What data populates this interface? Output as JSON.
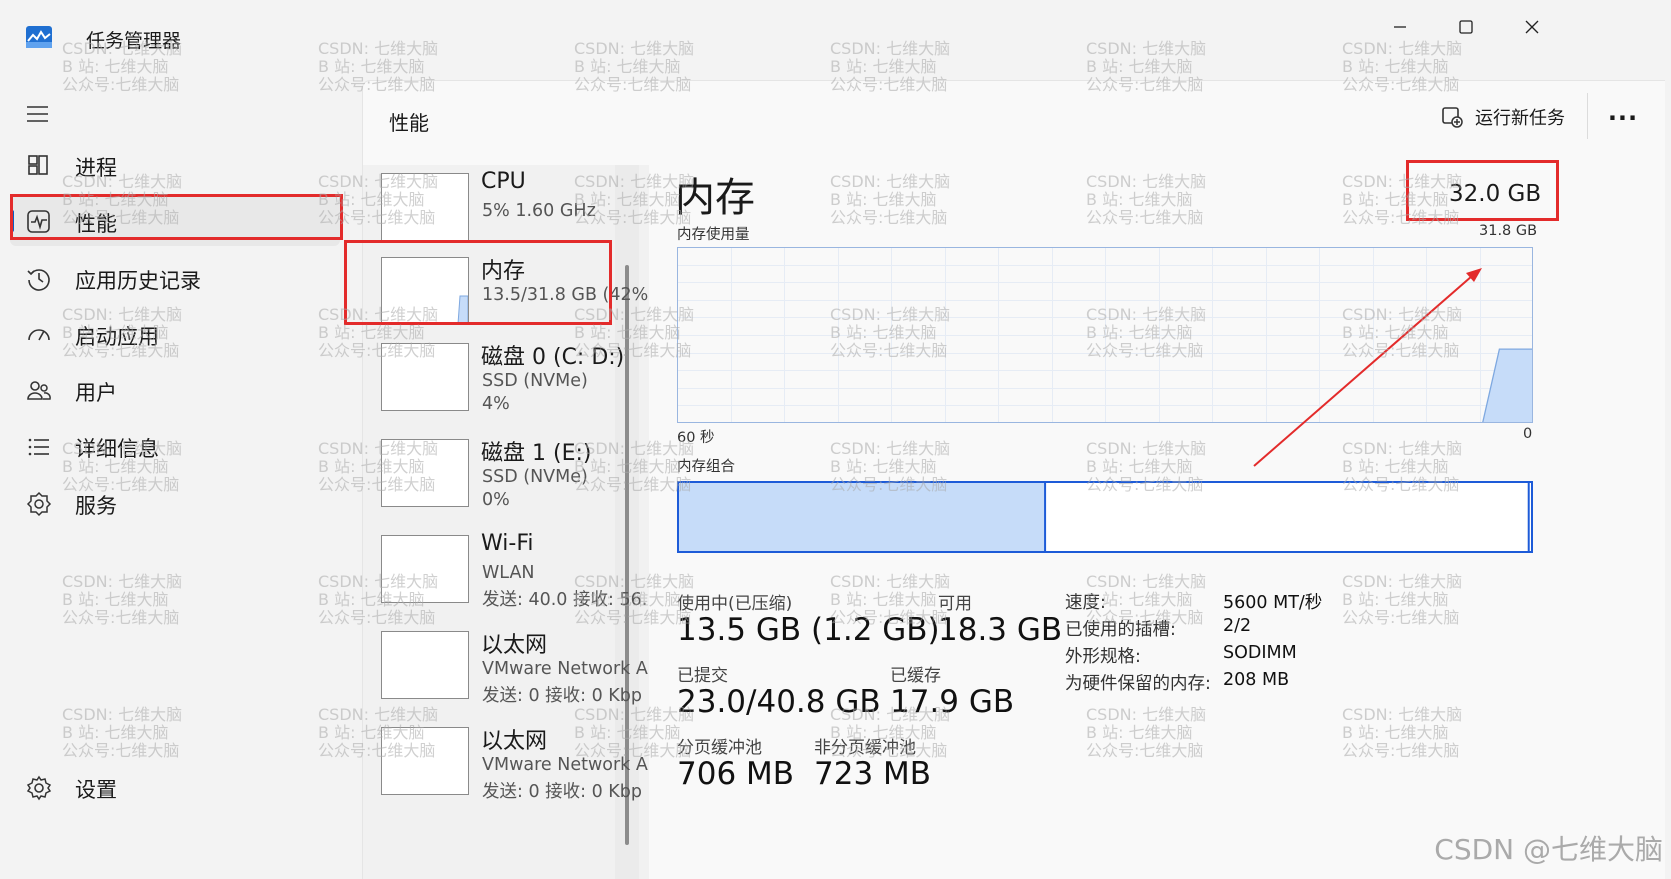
{
  "window": {
    "title": "任务管理器",
    "minimize_icon": "minimize-icon",
    "maximize_icon": "maximize-icon",
    "close_icon": "close-icon"
  },
  "sidebar": {
    "menu_icon": "hamburger-icon",
    "items": [
      {
        "label": "进程",
        "icon": "processes-icon",
        "active": false
      },
      {
        "label": "性能",
        "icon": "performance-icon",
        "active": true
      },
      {
        "label": "应用历史记录",
        "icon": "history-icon",
        "active": false
      },
      {
        "label": "启动应用",
        "icon": "startup-icon",
        "active": false
      },
      {
        "label": "用户",
        "icon": "users-icon",
        "active": false
      },
      {
        "label": "详细信息",
        "icon": "details-icon",
        "active": false
      },
      {
        "label": "服务",
        "icon": "services-icon",
        "active": false
      }
    ],
    "settings": {
      "label": "设置",
      "icon": "gear-icon"
    }
  },
  "header": {
    "title": "性能",
    "run_task_label": "运行新任务",
    "run_task_icon": "run-task-icon",
    "more_label": "···"
  },
  "devices": [
    {
      "name": "CPU",
      "line1": "5%  1.60 GHz",
      "line2": ""
    },
    {
      "name": "内存",
      "line1": "13.5/31.8 GB (42%)",
      "line2": "",
      "selected": true,
      "fill_fraction": 0.42
    },
    {
      "name": "磁盘 0 (C: D:)",
      "line1": "SSD (NVMe)",
      "line2": "4%"
    },
    {
      "name": "磁盘 1 (E:)",
      "line1": "SSD (NVMe)",
      "line2": "0%"
    },
    {
      "name": "Wi-Fi",
      "line1": "WLAN",
      "line2": "发送: 40.0  接收: 56."
    },
    {
      "name": "以太网",
      "line1": "VMware Network A",
      "line2": "发送: 0  接收: 0 Kbp"
    },
    {
      "name": "以太网",
      "line1": "VMware Network A",
      "line2": "发送: 0  接收: 0 Kbp"
    }
  ],
  "memory": {
    "title": "内存",
    "total": "32.0 GB",
    "usage_label": "内存使用量",
    "usage_max": "31.8 GB",
    "time_left": "60 秒",
    "time_right": "0",
    "composition_label": "内存组合",
    "composition": {
      "in_use_fraction": 0.43,
      "standby_fraction": 0.565,
      "free_fraction": 0.005
    },
    "usage_history": [
      0,
      0,
      0,
      0,
      0,
      0,
      0,
      0,
      0,
      0,
      0,
      0,
      0,
      0,
      0,
      0,
      0,
      0,
      0,
      0,
      0,
      0,
      0,
      0,
      0,
      0,
      0,
      0,
      0,
      0,
      0,
      0,
      0,
      0,
      0,
      0,
      0,
      0,
      0,
      0,
      0,
      0,
      0,
      0,
      0,
      0,
      0,
      0,
      0,
      0.42,
      0.42,
      0.42
    ],
    "stats": {
      "in_use_label": "使用中(已压缩)",
      "in_use_value": "13.5 GB (1.2 GB)",
      "available_label": "可用",
      "available_value": "18.3 GB",
      "committed_label": "已提交",
      "committed_value": "23.0/40.8 GB",
      "cached_label": "已缓存",
      "cached_value": "17.9 GB",
      "paged_label": "分页缓冲池",
      "paged_value": "706 MB",
      "nonpaged_label": "非分页缓冲池",
      "nonpaged_value": "723 MB"
    },
    "specs": [
      {
        "label": "速度:",
        "value": "5600 MT/秒"
      },
      {
        "label": "已使用的插槽:",
        "value": "2/2"
      },
      {
        "label": "外形规格:",
        "value": "SODIMM"
      },
      {
        "label": "为硬件保留的内存:",
        "value": "208 MB"
      }
    ]
  },
  "colors": {
    "accent": "#0a5ec2",
    "annotation_red": "#e32b2b",
    "memory_fill": "#c6dcf9",
    "memory_stroke": "#1d5bd8",
    "chart_line": "#7ea8e0"
  },
  "watermark": {
    "line1": "CSDN: 七维大脑",
    "line2": "B 站: 七维大脑",
    "line3": "公众号:七维大脑",
    "corner": "CSDN @七维大脑"
  }
}
